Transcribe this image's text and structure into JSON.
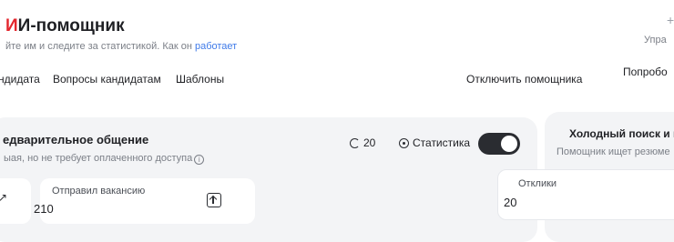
{
  "header": {
    "title_accent": "И",
    "title_rest": "И-помощник",
    "subtitle_text": "йте им и следите за статистикой. Как он",
    "subtitle_link": "работает",
    "right_top_icon": "+",
    "right_top_text": "Упра"
  },
  "tabs": [
    {
      "label": "ндидата"
    },
    {
      "label": "Вопросы кандидатам"
    },
    {
      "label": "Шаблоны"
    }
  ],
  "toolbar": {
    "disable_assistant": "Отключить помощника",
    "right_button": "Попробо"
  },
  "main_card": {
    "title": "едварительное общение",
    "description": "ыая, но не требует оплаченного доступа",
    "info_icon": "info-icon",
    "count": "20",
    "stats_label": "Статистика",
    "toggle_on": true,
    "stat_left_icon": "arrow-icon",
    "stat_label": "Отправил вакансию",
    "stat_value": "210",
    "upload_icon": "upload-icon"
  },
  "side_card": {
    "title": "Холодный поиск и п",
    "description": "Помощник ищет резюме",
    "stat_label": "Отклики",
    "stat_value": "20"
  }
}
